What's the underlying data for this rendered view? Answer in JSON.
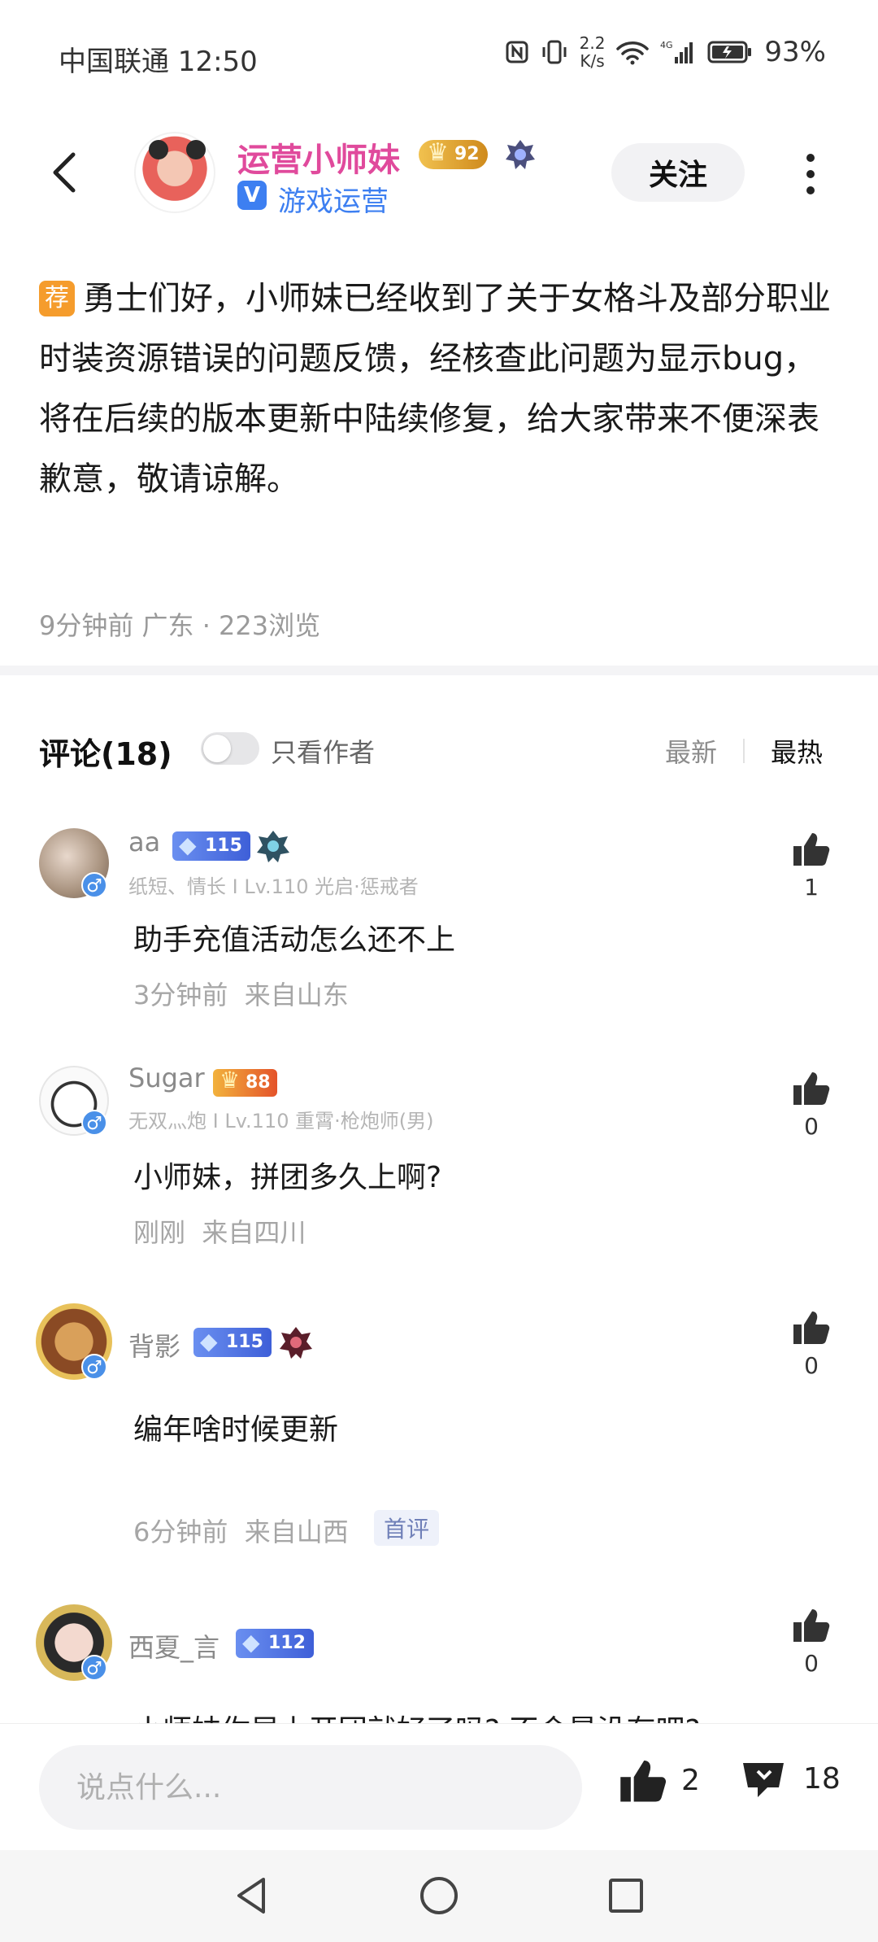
{
  "status_bar": {
    "carrier_time": "中国联通 12:50",
    "net_speed_value": "2.2",
    "net_speed_unit": "K/s",
    "battery": "93%"
  },
  "header": {
    "author_name": "运营小师妹",
    "level": "92",
    "verified_mark": "V",
    "author_role": "游戏运营",
    "follow_label": "关注"
  },
  "post": {
    "tag": "荐",
    "content": "勇士们好，小师妹已经收到了关于女格斗及部分职业时装资源错误的问题反馈，经核查此问题为显示bug，将在后续的版本更新中陆续修复，给大家带来不便深表歉意，敬请谅解。",
    "meta": "9分钟前 广东 · 223浏览"
  },
  "comments_section": {
    "title": "评论(18)",
    "only_author_label": "只看作者",
    "sort_new": "最新",
    "sort_hot": "最热",
    "items": [
      {
        "name": "aa",
        "badge_level": "115",
        "subtitle": "纸短、情长 I Lv.110 光启·惩戒者",
        "gender": "♂",
        "text": "助手充值活动怎么还不上",
        "time": "3分钟前",
        "location": "来自山东",
        "likes": "1"
      },
      {
        "name": "Sugar",
        "badge_level": "88",
        "subtitle": "无双灬炮 I Lv.110 重霄·枪炮师(男)",
        "gender": "♂",
        "text": "小师妹，拼团多久上啊?",
        "time": "刚刚",
        "location": "来自四川",
        "likes": "0"
      },
      {
        "name": "背影",
        "badge_level": "115",
        "subtitle": "",
        "gender": "♂",
        "text": "编年啥时候更新",
        "time": "6分钟前",
        "location": "来自山西",
        "first_tag": "首评",
        "likes": "0"
      },
      {
        "name": "西夏_言",
        "badge_level": "112",
        "subtitle": "",
        "gender": "♂",
        "text": "小师妹你早上开团就好了吗? 不会是没有吧?",
        "likes": "0"
      }
    ]
  },
  "bottom_bar": {
    "input_placeholder": "说点什么...",
    "like_count": "2",
    "comment_count": "18"
  },
  "colors": {
    "author_pink": "#e04a9c",
    "verified_blue": "#3d7ff1",
    "rec_tag_orange": "#f59c2c"
  }
}
